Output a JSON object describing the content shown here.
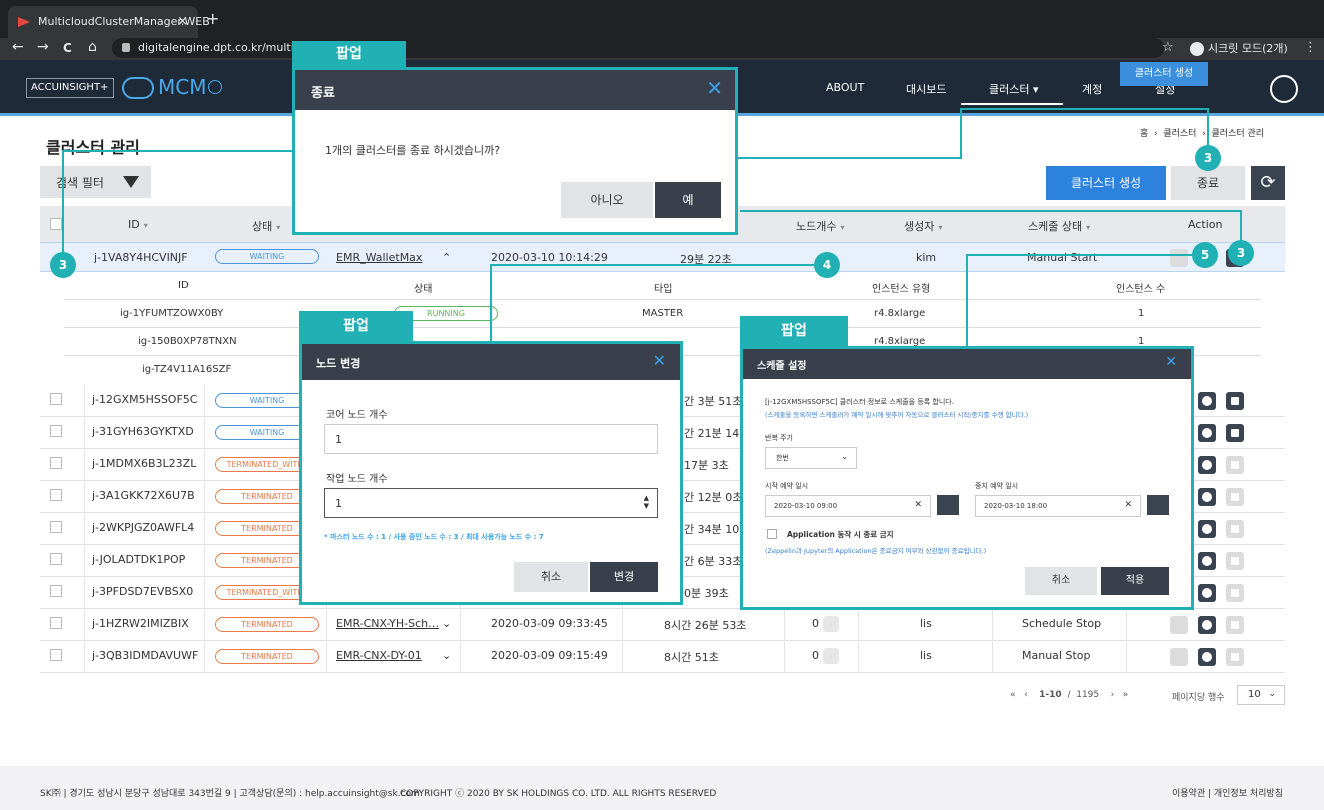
{
  "browser": {
    "tab_title": "MulticloudClusterManager.WEB",
    "tab_close": "×",
    "new_tab": "+",
    "back": "←",
    "forward": "→",
    "reload": "C",
    "home": "⌂",
    "url": "digitalengine.dpt.co.kr/multiclo",
    "star": "☆",
    "incognito_label": "시크릿 모드(2개)",
    "menu": "⋮"
  },
  "app": {
    "brand": "ACCUINSIGHT+",
    "product": "MCM",
    "nav": [
      "ABOUT",
      "대시보드",
      "클러스터",
      "계정",
      "설정"
    ],
    "create_badge": "클러스터 생성"
  },
  "page": {
    "title": "클러스터 관리",
    "breadcrumb": [
      "홈",
      "클러스터",
      "클러스터 관리"
    ],
    "filter_label": "검색 필터",
    "create_button": "클러스터 생성",
    "end_button": "종료",
    "refresh_icon": "⟳"
  },
  "table": {
    "headers": [
      "ID",
      "상태",
      "노드개수",
      "생성자",
      "스케줄 상태",
      "Action"
    ],
    "expanded_row": {
      "id": "j-1VA8Y4HCVINJF",
      "status": "WAITING",
      "name": "EMR_WalletMax",
      "created": "2020-03-10 10:14:29",
      "elapsed": "29분 22초",
      "creator": "kim",
      "schedule": "Manual Start"
    },
    "sub_headers": [
      "ID",
      "상태",
      "타입",
      "인스턴스 유형",
      "인스턴스 수"
    ],
    "sub_rows": [
      {
        "id": "ig-1YFUMTZOWX0BY",
        "status": "RUNNING",
        "type": "MASTER",
        "itype": "r4.8xlarge",
        "count": "1"
      },
      {
        "id": "ig-150B0XP78TNXN",
        "status": "",
        "type": "",
        "itype": "r4.8xlarge",
        "count": "1"
      },
      {
        "id": "ig-TZ4V11A16SZF",
        "status": "",
        "type": "",
        "itype": "",
        "count": ""
      }
    ],
    "rows": [
      {
        "id": "j-12GXM5HSSOF5C",
        "status": "WAITING",
        "elapsed": "간 3분 51초",
        "running": true
      },
      {
        "id": "j-31GYH63GYKTXD",
        "status": "WAITING",
        "elapsed": "간 21분 14초",
        "running": true
      },
      {
        "id": "j-1MDMX6B3L23ZL",
        "status": "TERMINATED_WITH_",
        "elapsed": "17분 3초",
        "running": false
      },
      {
        "id": "j-3A1GKK72X6U7B",
        "status": "TERMINATED",
        "elapsed": "간 12분 0초",
        "running": false
      },
      {
        "id": "j-2WKPJGZ0AWFL4",
        "status": "TERMINATED",
        "elapsed": "간 34분 10초",
        "running": false
      },
      {
        "id": "j-JOLADTDK1POP",
        "status": "TERMINATED",
        "elapsed": "간 6분 33초",
        "running": false
      },
      {
        "id": "j-3PFDSD7EVBSX0",
        "status": "TERMINATED_WITH_",
        "elapsed": "0분 39초",
        "running": false
      },
      {
        "id": "j-1HZRW2IMIZBIX",
        "status": "TERMINATED",
        "name": "EMR-CNX-YH-Sch…",
        "created": "2020-03-09 09:33:45",
        "elapsed": "8시간 26분 53초",
        "nodes": "0",
        "creator": "lis",
        "schedule": "Schedule Stop",
        "running": false
      },
      {
        "id": "j-3QB3IDMDAVUWF",
        "status": "TERMINATED",
        "name": "EMR-CNX-DY-01",
        "created": "2020-03-09 09:15:49",
        "elapsed": "8시간 51초",
        "nodes": "0",
        "creator": "lis",
        "schedule": "Manual Stop",
        "running": false
      }
    ]
  },
  "pagination": {
    "first": "«",
    "prev": "‹",
    "range": "1-10",
    "sep": "/",
    "total": "1195",
    "next": "›",
    "last": "»",
    "per_page_label": "페이지당 행수",
    "per_page": "10"
  },
  "footer": {
    "company": "SK㈜ | 경기도 성남시 분당구 성남대로 343번길 9 | 고객상담(문의) : help.accuinsight@sk.com",
    "copyright": "COPYRIGHT ⓒ 2020 BY SK HOLDINGS CO. LTD. ALL RIGHTS RESERVED",
    "links": "이용약관 | 개인정보 처리방침"
  },
  "popup_tag": "팝업",
  "end_popup": {
    "title": "종료",
    "message": "1개의 클러스터를 종료 하시겠습니까?",
    "no": "아니오",
    "yes": "예"
  },
  "node_popup": {
    "title": "노드 변경",
    "core_label": "코어 노드 개수",
    "core_value": "1",
    "task_label": "작업 노드 개수",
    "task_value": "1",
    "note": "* 마스터 노드 수 : 1 / 사용 중인 노드 수 : 3 / 최대 사용가능 노드 수 : 7",
    "cancel": "취소",
    "apply": "변경"
  },
  "schedule_popup": {
    "title": "스케줄 설정",
    "desc1": "[j-12GXM5HSSOF5C] 클러스터 정보로 스케줄을 등록 합니다.",
    "desc2": "(스케줄을 등록하면 스케줄러가 예약 일시에 맞추어 자동으로 클러스터 시작/중지를 수행 합니다.)",
    "repeat_label": "반복 주기",
    "repeat_value": "한번",
    "start_label": "시작 예약 일시",
    "start_value": "2020-03-10 09:00",
    "stop_label": "중지 예약 일시",
    "stop_value": "2020-03-10 18:00",
    "app_label": "Application 동작 시 종료 금지",
    "app_note": "(Zeppelin과 Jupyter의 Application은 종료금지 여부와 상관없이 종료됩니다.)",
    "cancel": "취소",
    "apply": "적용"
  },
  "callouts": [
    "3",
    "3",
    "4",
    "5",
    "3"
  ],
  "colors": {
    "accent": "#21b0b4",
    "header": "#1f2a38",
    "primary": "#2c82dd"
  }
}
